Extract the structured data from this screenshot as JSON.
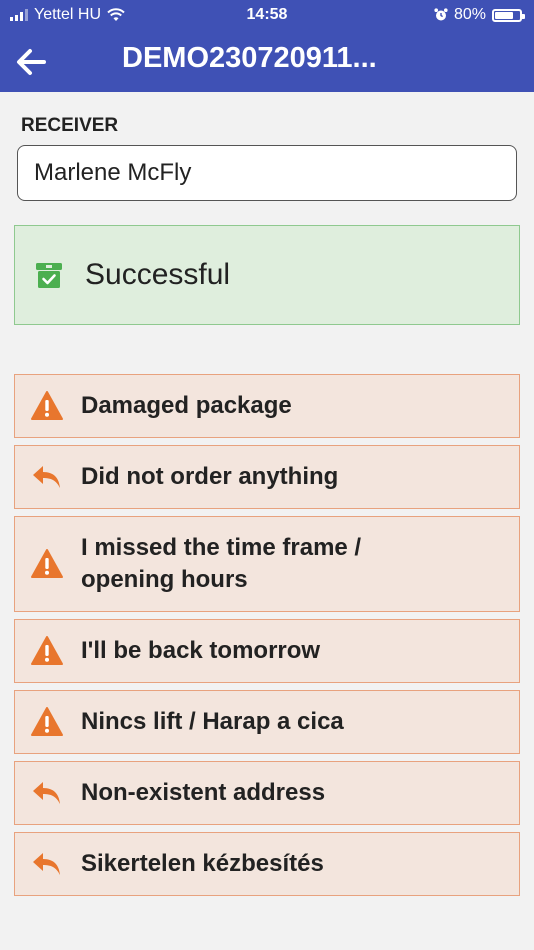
{
  "status_bar": {
    "carrier": "Yettel HU",
    "time": "14:58",
    "battery_percent": "80%",
    "battery_level": 0.8,
    "icons": [
      "signal-icon",
      "wifi-icon",
      "alarm-icon",
      "battery-icon"
    ]
  },
  "app_bar": {
    "title": "DEMO230720911...",
    "back_icon": "arrow-left-icon"
  },
  "receiver": {
    "label": "RECEIVER",
    "value": "Marlene McFly"
  },
  "success": {
    "label": "Successful",
    "icon": "package-check-icon",
    "color": "#4caf50"
  },
  "failure_options": [
    {
      "label": "Damaged package",
      "icon": "warning-icon"
    },
    {
      "label": "Did not order anything",
      "icon": "reply-icon"
    },
    {
      "label": "I missed the time frame / opening hours",
      "icon": "warning-icon"
    },
    {
      "label": "I'll be back tomorrow",
      "icon": "warning-icon"
    },
    {
      "label": "Nincs lift / Harap a cica",
      "icon": "warning-icon"
    },
    {
      "label": "Non-existent address",
      "icon": "reply-icon"
    },
    {
      "label": "Sikertelen kézbesítés",
      "icon": "reply-icon"
    }
  ],
  "colors": {
    "primary": "#3f51b5",
    "success_bg": "#dfeedd",
    "failure_bg": "#f3e5dd",
    "failure_accent": "#e8762d"
  }
}
